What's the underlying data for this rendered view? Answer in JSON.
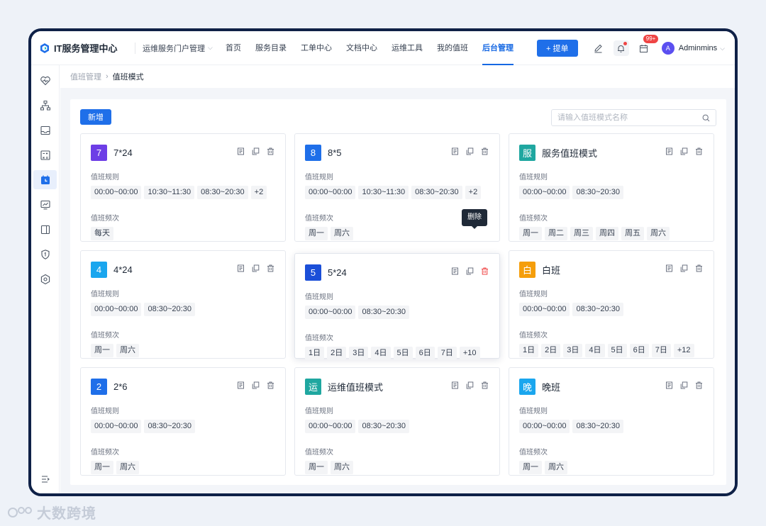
{
  "app": {
    "title": "IT服务管理中心"
  },
  "header": {
    "portal": "运维服务门户管理",
    "nav": [
      "首页",
      "服务目录",
      "工单中心",
      "文档中心",
      "运维工具",
      "我的值班",
      "后台管理"
    ],
    "active_nav": "后台管理",
    "submit_label": "+ 提单",
    "badge_count": "99+",
    "username": "Adminmins",
    "avatar_letter": "A"
  },
  "breadcrumb": {
    "parent": "值班管理",
    "current": "值班模式"
  },
  "toolbar": {
    "add_label": "新增",
    "search_placeholder": "请输入值班模式名称"
  },
  "labels": {
    "rule": "值班规则",
    "frequency": "值班频次"
  },
  "tooltip": "删除",
  "cards": [
    {
      "icon": "7",
      "color": "#6d3ee6",
      "title": "7*24",
      "rules": [
        "00:00~00:00",
        "10:30~11:30",
        "08:30~20:30",
        "+2"
      ],
      "freq": [
        "每天"
      ]
    },
    {
      "icon": "8",
      "color": "#1f6fe9",
      "title": "8*5",
      "rules": [
        "00:00~00:00",
        "10:30~11:30",
        "08:30~20:30",
        "+2"
      ],
      "freq": [
        "周一",
        "周六"
      ]
    },
    {
      "icon": "服",
      "color": "#1fa7a0",
      "title": "服务值班模式",
      "rules": [
        "00:00~00:00",
        "08:30~20:30"
      ],
      "freq": [
        "周一",
        "周二",
        "周三",
        "周四",
        "周五",
        "周六"
      ]
    },
    {
      "icon": "4",
      "color": "#1aa6ee",
      "title": "4*24",
      "rules": [
        "00:00~00:00",
        "08:30~20:30"
      ],
      "freq": [
        "周一",
        "周六"
      ]
    },
    {
      "icon": "5",
      "color": "#1b4fd8",
      "title": "5*24",
      "rules": [
        "00:00~00:00",
        "08:30~20:30"
      ],
      "freq": [
        "1日",
        "2日",
        "3日",
        "4日",
        "5日",
        "6日",
        "7日",
        "+10"
      ]
    },
    {
      "icon": "白",
      "color": "#f59e0b",
      "title": "白班",
      "rules": [
        "00:00~00:00",
        "08:30~20:30"
      ],
      "freq": [
        "1日",
        "2日",
        "3日",
        "4日",
        "5日",
        "6日",
        "7日",
        "+12"
      ]
    },
    {
      "icon": "2",
      "color": "#1f6fe9",
      "title": "2*6",
      "rules": [
        "00:00~00:00",
        "08:30~20:30"
      ],
      "freq": [
        "周一",
        "周六"
      ]
    },
    {
      "icon": "运",
      "color": "#1fa7a0",
      "title": "运维值班模式",
      "rules": [
        "00:00~00:00",
        "08:30~20:30"
      ],
      "freq": [
        "周一",
        "周六"
      ]
    },
    {
      "icon": "晚",
      "color": "#1aa6ee",
      "title": "晚班",
      "rules": [
        "00:00~00:00",
        "08:30~20:30"
      ],
      "freq": [
        "周一",
        "周六"
      ]
    }
  ],
  "watermark": "大数跨境"
}
